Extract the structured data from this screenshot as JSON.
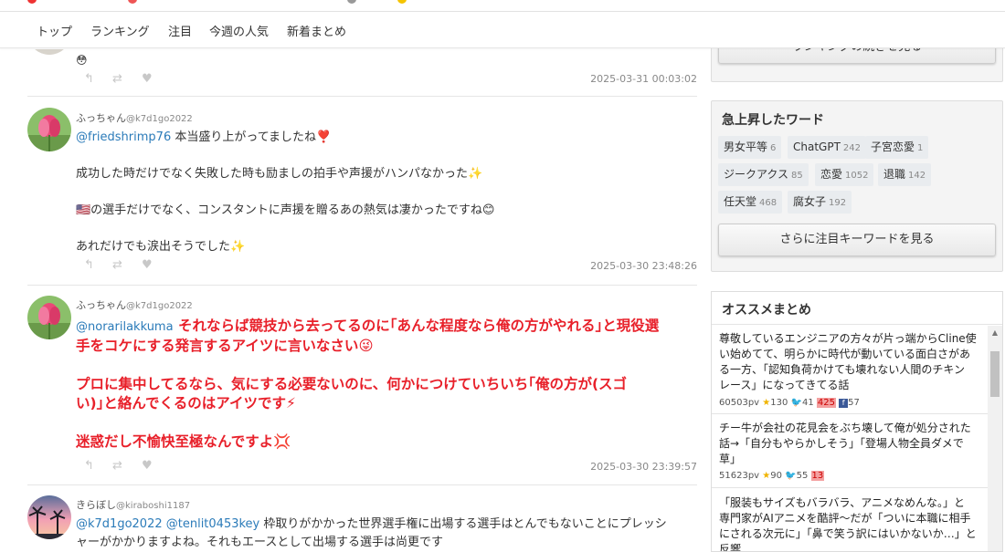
{
  "nav": {
    "items": [
      "トップ",
      "ランキング",
      "注目",
      "今週の人気",
      "新着まとめ"
    ]
  },
  "top_post": {
    "text": "😳",
    "timestamp": "2025-03-31 00:03:02"
  },
  "posts": [
    {
      "user": "ふっちゃん",
      "handle": "@k7d1go2022",
      "lines": [
        {
          "mention": "@friedshrimp76",
          "text": " 本当盛り上がってましたね❣️"
        },
        {
          "gap": true
        },
        {
          "text": "成功した時だけでなく失敗した時も励ましの拍手や声援がハンパなかった✨"
        },
        {
          "gap": true
        },
        {
          "text": "🇺🇸の選手だけでなく、コンスタントに声援を贈るあの熱気は凄かったですね😊"
        },
        {
          "gap": true
        },
        {
          "text": "あれだけでも涙出そうでした✨"
        }
      ],
      "timestamp": "2025-03-30 23:48:26"
    },
    {
      "user": "ふっちゃん",
      "handle": "@k7d1go2022",
      "lines": [
        {
          "mention": "@norarilakkuma",
          "text": " それならば競技から去ってるのに｢あんな程度なら俺の方がやれる｣と現役選"
        },
        {
          "text": "手をコケにする発言するアイツに言いなさい😜"
        },
        {
          "gap": true
        },
        {
          "text": "プロに集中してるなら、気にする必要ないのに、何かにつけていちいち｢俺の方が(スゴ"
        },
        {
          "text": "い)｣と絡んでくるのはアイツです⚡"
        },
        {
          "gap": true
        },
        {
          "text": "迷惑だし不愉快至極なんですよ💢"
        }
      ],
      "timestamp": "2025-03-30 23:39:57"
    },
    {
      "user": "きらぼし",
      "handle": "@kiraboshi1187",
      "lines": [
        {
          "mention": "@k7d1go2022 @tenlit0453key",
          "text": " 枠取りがかかった世界選手権に出場する選手はとんでもないことにプレッシ"
        },
        {
          "text": "ャーがかかりますよね。それもエースとして出場する選手は尚更です"
        }
      ],
      "timestamp": ""
    }
  ],
  "ranking_more": {
    "label": "ランキングの続きを見る"
  },
  "trending": {
    "title": "急上昇したワード",
    "keywords": [
      {
        "word": "男女平等",
        "count": "6"
      },
      {
        "word": "ChatGPT",
        "count": "242"
      },
      {
        "word": "子宮恋愛",
        "count": "1"
      },
      {
        "word": "ジークアクス",
        "count": "85"
      },
      {
        "word": "恋愛",
        "count": "1052"
      },
      {
        "word": "退職",
        "count": "142"
      },
      {
        "word": "任天堂",
        "count": "468"
      },
      {
        "word": "腐女子",
        "count": "192"
      }
    ],
    "more_label": "さらに注目キーワードを見る"
  },
  "recommended": {
    "title": "オススメまとめ",
    "items": [
      {
        "lines": [
          "尊敬しているエンジニアの方々が片っ端からCline使",
          "い始めてて、明らかに時代が動いている面白さがあ",
          "る一方、「認知負荷かけても壊れない人間のチキン",
          "レース」になってきてる話"
        ],
        "pv": "60503",
        "star": "130",
        "tw": "41",
        "hb": "425",
        "fb": "57"
      },
      {
        "lines": [
          "チー牛が会社の花見会をぶち壊して俺が処分された",
          "話→「自分もやらかしそう」「登場人物全員ダメで",
          "草」"
        ],
        "pv": "51623",
        "star": "90",
        "tw": "55",
        "hb": "13"
      },
      {
        "lines": [
          "「服装もサイズもバラバラ、アニメなめんな。」と",
          "専門家がAIアニメを酷評～だが「ついに本職に相手",
          "にされる次元に」「鼻で笑う訳にはいかないか…」と",
          "反響"
        ]
      }
    ]
  },
  "icons": [
    "reply-icon",
    "retweet-icon",
    "heart-icon",
    "star-icon",
    "twitter-icon",
    "facebook-icon",
    "scroll-up-icon"
  ],
  "colors": {
    "mention": "#2b7bb9",
    "emphasis": "#e8202a",
    "timestamp": "#888888"
  }
}
